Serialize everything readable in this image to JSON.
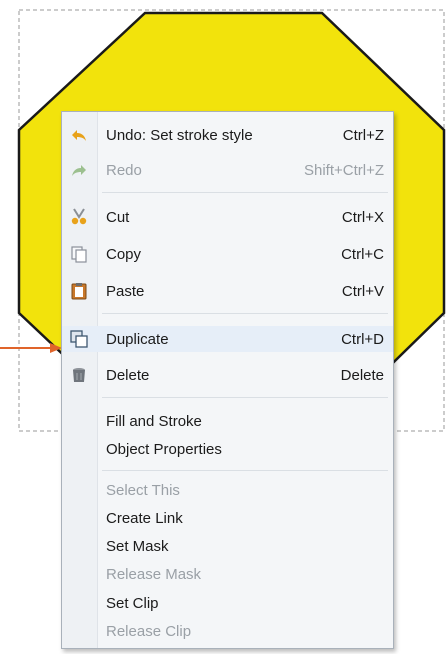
{
  "colors": {
    "shape_fill": "#f2e30c",
    "shape_stroke": "#1a1a1a",
    "arrow": "#e0642a",
    "menu_bg": "#f4f6f8",
    "hover_bg": "#e6eef8"
  },
  "menu": {
    "items": [
      {
        "label": "Undo: Set stroke style",
        "shortcut": "Ctrl+Z",
        "icon": "undo-arrow-icon",
        "enabled": true
      },
      {
        "label": "Redo",
        "shortcut": "Shift+Ctrl+Z",
        "icon": "redo-arrow-icon",
        "enabled": false
      },
      {
        "label": "Cut",
        "shortcut": "Ctrl+X",
        "icon": "scissors-icon",
        "enabled": true
      },
      {
        "label": "Copy",
        "shortcut": "Ctrl+C",
        "icon": "copy-icon",
        "enabled": true
      },
      {
        "label": "Paste",
        "shortcut": "Ctrl+V",
        "icon": "paste-clipboard-icon",
        "enabled": true
      },
      {
        "label": "Duplicate",
        "shortcut": "Ctrl+D",
        "icon": "duplicate-icon",
        "enabled": true,
        "highlighted": true
      },
      {
        "label": "Delete",
        "shortcut": "Delete",
        "icon": "trash-can-icon",
        "enabled": true
      },
      {
        "label": "Fill and Stroke",
        "shortcut": "",
        "enabled": true
      },
      {
        "label": "Object Properties",
        "shortcut": "",
        "enabled": true
      },
      {
        "label": "Select This",
        "shortcut": "",
        "enabled": false
      },
      {
        "label": "Create Link",
        "shortcut": "",
        "enabled": true
      },
      {
        "label": "Set Mask",
        "shortcut": "",
        "enabled": true
      },
      {
        "label": "Release Mask",
        "shortcut": "",
        "enabled": false
      },
      {
        "label": "Set Clip",
        "shortcut": "",
        "enabled": true
      },
      {
        "label": "Release Clip",
        "shortcut": "",
        "enabled": false
      }
    ]
  }
}
